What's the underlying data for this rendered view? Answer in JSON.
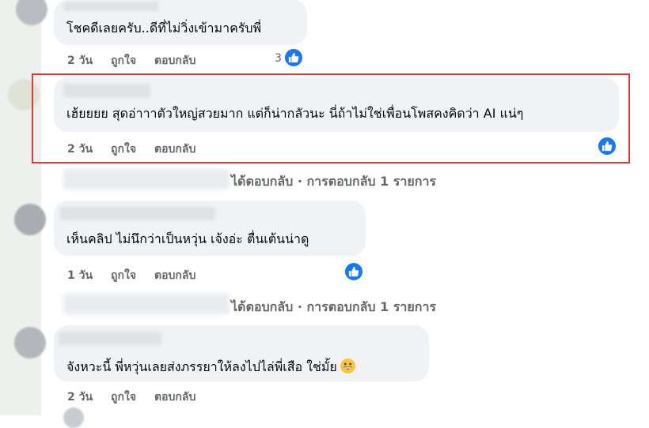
{
  "comments": [
    {
      "text": "โชคดีเลยครับ..ดีที่ไม่วิ่งเข้ามาครับพี่",
      "time": "2 วัน",
      "like_label": "ถูกใจ",
      "reply_label": "ตอบกลับ",
      "reactions": "3"
    },
    {
      "text": "เฮ้ยยยย สุดอ่าาาตัวใหญ่สวยมาก แต่ก็น่ากลัวนะ นี่ถ้าไม่ใช่เพื่อนโพสคงคิดว่า AI แน่ๆ",
      "time": "2 วัน",
      "like_label": "ถูกใจ",
      "reply_label": "ตอบกลับ",
      "highlighted": true
    },
    {
      "text": "เห็นคลิป ไม่นึกว่าเป็นหวุ่น เจ้งอ่ะ ตื่นเต้นน่าดู",
      "time": "1 วัน",
      "like_label": "ถูกใจ",
      "reply_label": "ตอบกลับ"
    },
    {
      "text": "จังหวะนี้ พี่หวุ่นเลยส่งภรรยาให้ลงไปไล่พี่เสือ ใช่มั้ย",
      "time": "2 วัน",
      "like_label": "ถูกใจ",
      "reply_label": "ตอบกลับ",
      "emoji": "grinning-face"
    }
  ],
  "reply_links": [
    {
      "text": "ได้ตอบกลับ · การตอบกลับ 1 รายการ"
    },
    {
      "text": "ได้ตอบกลับ · การตอบกลับ 1 รายการ"
    }
  ],
  "colors": {
    "like_blue": "#1877f2",
    "highlight_red": "#e0383e",
    "bubble": "#f0f2f5",
    "action_gray": "#65676b"
  },
  "icons": [
    "like-icon",
    "grinning-face-emoji"
  ]
}
